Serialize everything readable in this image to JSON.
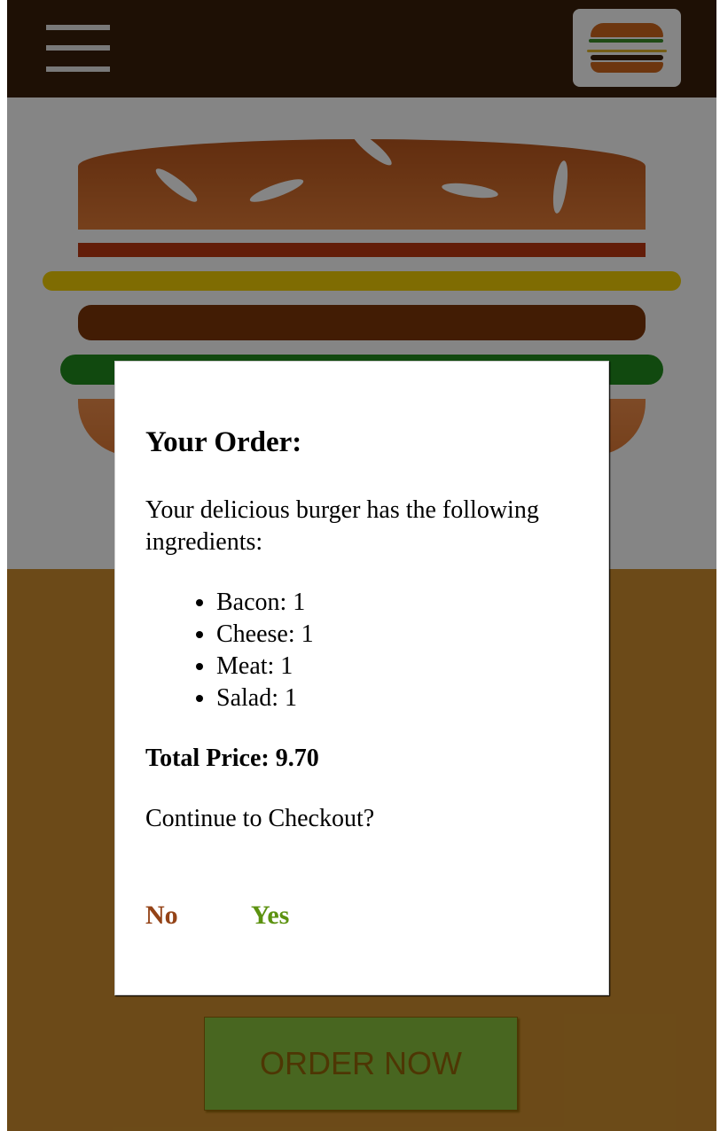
{
  "toolbar": {
    "menu_icon": "hamburger-menu-icon",
    "logo_icon": "burger-logo-icon"
  },
  "colors": {
    "toolbar": "#3a1f0a",
    "build_controls": "#cf8f2e",
    "order_button": "#8ac43f",
    "order_button_text": "#966909",
    "no_button": "#944317",
    "yes_button": "#5c9210"
  },
  "order_button": {
    "label": "ORDER NOW"
  },
  "modal": {
    "title": "Your Order:",
    "intro": "Your delicious burger has the following ingredients:",
    "ingredients": [
      {
        "name": "Bacon",
        "quantity": 1,
        "text": "Bacon: 1"
      },
      {
        "name": "Cheese",
        "quantity": 1,
        "text": "Cheese: 1"
      },
      {
        "name": "Meat",
        "quantity": 1,
        "text": "Meat: 1"
      },
      {
        "name": "Salad",
        "quantity": 1,
        "text": "Salad: 1"
      }
    ],
    "total_price_label": "Total Price: 9.70",
    "continue_prompt": "Continue to Checkout?",
    "no_label": "No",
    "yes_label": "Yes"
  }
}
